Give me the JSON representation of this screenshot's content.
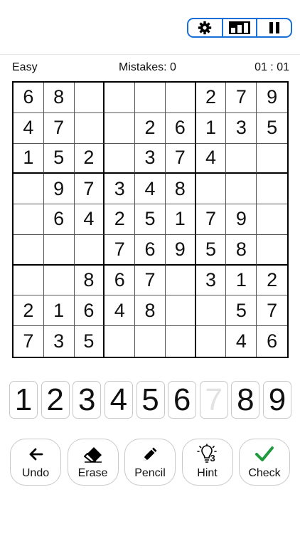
{
  "header": {
    "controls": [
      {
        "name": "settings",
        "icon": "gear-icon"
      },
      {
        "name": "stats",
        "icon": "bar-chart-icon"
      },
      {
        "name": "pause",
        "icon": "pause-icon"
      }
    ],
    "accent_color": "#1a6fd6"
  },
  "status": {
    "difficulty": "Easy",
    "mistakes": "Mistakes: 0",
    "timer": "01 : 01"
  },
  "board": [
    [
      "6",
      "8",
      "",
      "",
      "",
      "",
      "2",
      "7",
      "9"
    ],
    [
      "4",
      "7",
      "",
      "",
      "2",
      "6",
      "1",
      "3",
      "5"
    ],
    [
      "1",
      "5",
      "2",
      "",
      "3",
      "7",
      "4",
      "",
      ""
    ],
    [
      "",
      "9",
      "7",
      "3",
      "4",
      "8",
      "",
      "",
      ""
    ],
    [
      "",
      "6",
      "4",
      "2",
      "5",
      "1",
      "7",
      "9",
      ""
    ],
    [
      "",
      "",
      "",
      "7",
      "6",
      "9",
      "5",
      "8",
      ""
    ],
    [
      "",
      "",
      "8",
      "6",
      "7",
      "",
      "3",
      "1",
      "2"
    ],
    [
      "2",
      "1",
      "6",
      "4",
      "8",
      "",
      "",
      "5",
      "7"
    ],
    [
      "7",
      "3",
      "5",
      "",
      "",
      "",
      "",
      "4",
      "6"
    ]
  ],
  "numpad": [
    {
      "label": "1",
      "disabled": false
    },
    {
      "label": "2",
      "disabled": false
    },
    {
      "label": "3",
      "disabled": false
    },
    {
      "label": "4",
      "disabled": false
    },
    {
      "label": "5",
      "disabled": false
    },
    {
      "label": "6",
      "disabled": false
    },
    {
      "label": "7",
      "disabled": true
    },
    {
      "label": "8",
      "disabled": false
    },
    {
      "label": "9",
      "disabled": false
    }
  ],
  "actions": {
    "undo": {
      "label": "Undo",
      "icon": "arrow-left-icon"
    },
    "erase": {
      "label": "Erase",
      "icon": "eraser-icon"
    },
    "pencil": {
      "label": "Pencil",
      "icon": "pencil-icon"
    },
    "hint": {
      "label": "Hint",
      "icon": "lightbulb-icon",
      "count": "3"
    },
    "check": {
      "label": "Check",
      "icon": "checkmark-icon",
      "color": "#1f9a3c"
    }
  }
}
